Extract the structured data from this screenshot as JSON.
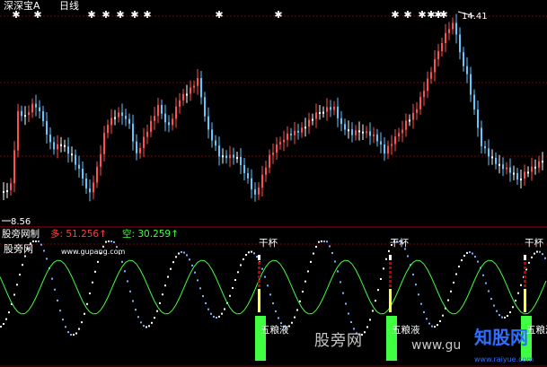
{
  "header": {
    "title": "深深宝A",
    "period": "日线"
  },
  "price_panel": {
    "high_label": "14.41",
    "low_label": "8.56"
  },
  "indicator_panel": {
    "title": "股旁网制",
    "duo_label": "多: 51.256↑",
    "kong_label": "空: 30.259↑",
    "signals": [
      {
        "top": "干杯",
        "bottom": "五粮液"
      },
      {
        "top": "干杯",
        "bottom": "五粮液"
      },
      {
        "top": "干杯",
        "bottom": "五粮液"
      }
    ]
  },
  "watermarks": {
    "site_name": "股旁网",
    "site_url": "www.gupang.com",
    "brand": "股旁网",
    "domain": "www.gu",
    "corner_logo": "知股网",
    "corner_url": "www.raiyue.com"
  },
  "colors": {
    "background": "#000000",
    "up_candle": "#ff5050",
    "down_candle": "#60c8ff",
    "neutral_candle": "#ffffff",
    "ma_line": "#40ff40",
    "signal_green": "#40ff40",
    "signal_yellow": "#ffff40",
    "grid": "#8b0000"
  }
}
